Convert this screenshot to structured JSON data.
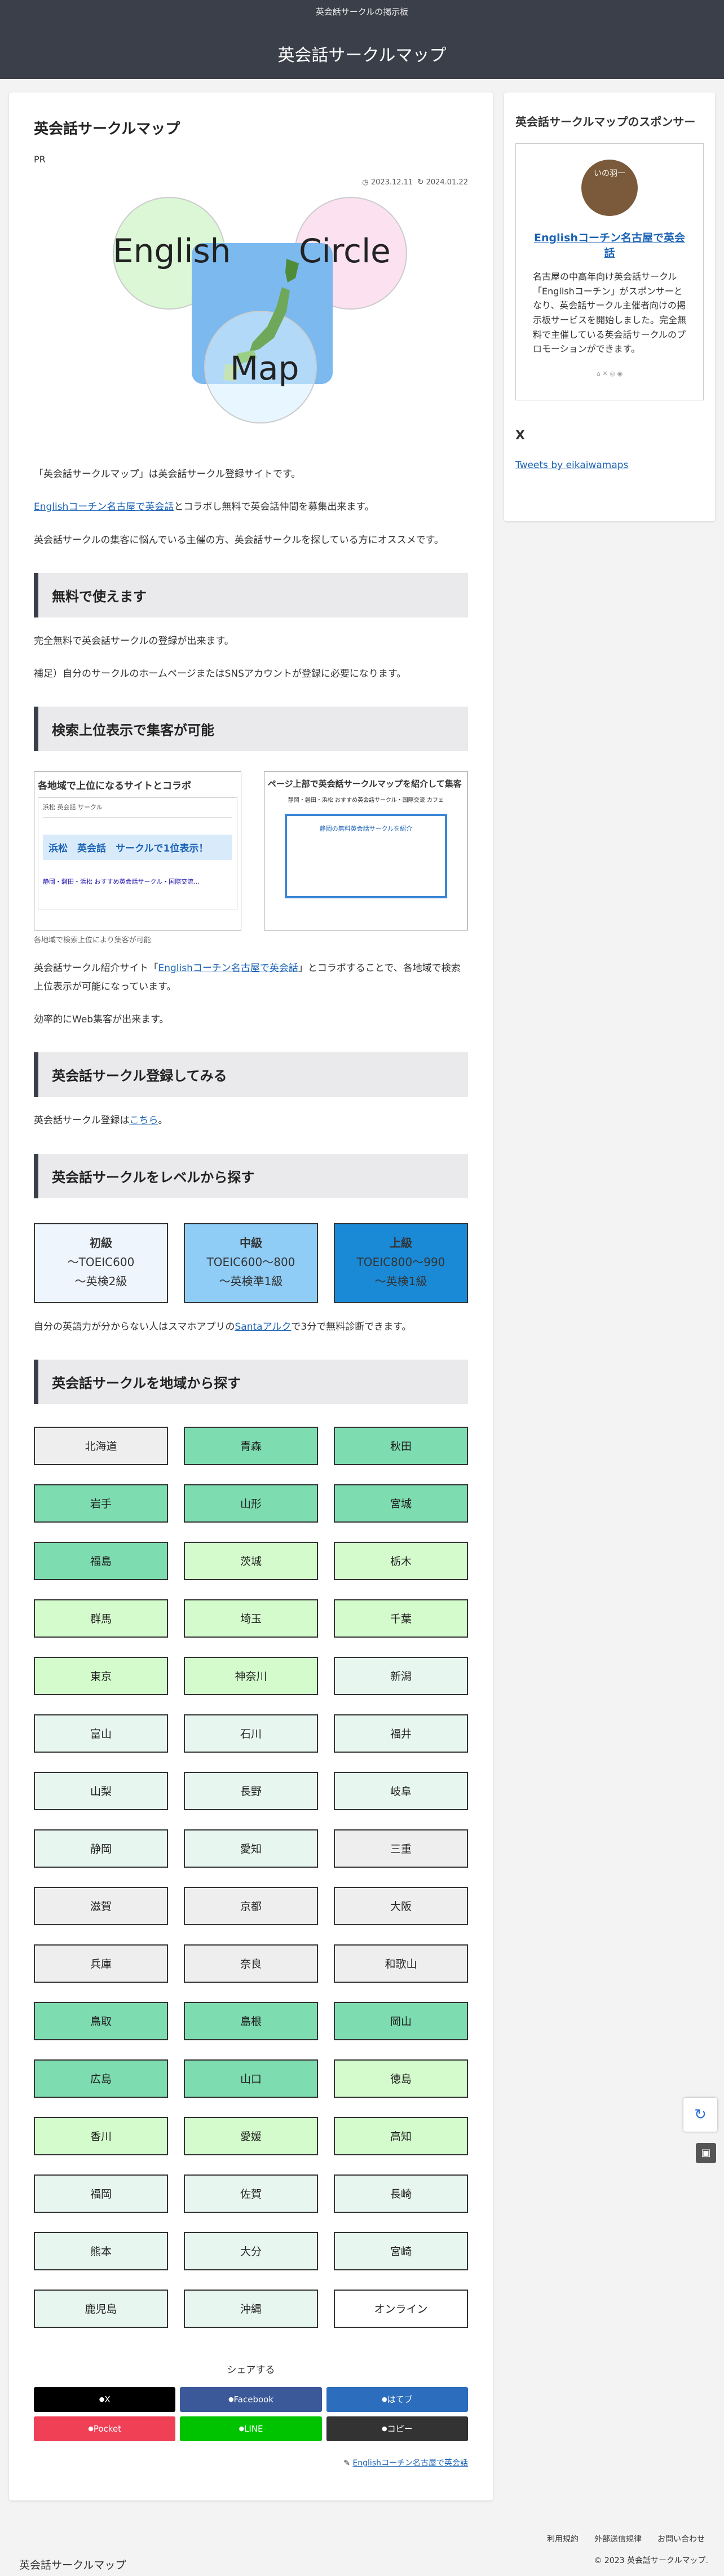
{
  "header": {
    "tagline": "英会話サークルの掲示板",
    "site_title": "英会話サークルマップ"
  },
  "article": {
    "title": "英会話サークルマップ",
    "pr": "PR",
    "created": "2023.12.11",
    "updated": "2024.01.22",
    "hero": {
      "word1": "English",
      "word2": "Circle",
      "word3": "Map"
    },
    "intro1": "「英会話サークルマップ」は英会話サークル登録サイトです。",
    "intro2_link": "Englishコーチン名古屋で英会話",
    "intro2_rest": "とコラボし無料で英会話仲間を募集出来ます。",
    "intro3": "英会話サークルの集客に悩んでいる主催の方、英会話サークルを探している方にオススメです。",
    "h_free": "無料で使えます",
    "free1": "完全無料で英会話サークルの登録が出来ます。",
    "free2": "補足）自分のサークルのホームページまたはSNSアカウントが登録に必要になります。",
    "h_seo": "検索上位表示で集客が可能",
    "shot1_title": "各地域で上位になるサイトとコラボ",
    "shot1_search": "浜松 英会話 サークル",
    "shot1_big": "浜松　英会話　サークルで1位表示！",
    "shot1_result": "静岡・磐田・浜松 おすすめ英会話サークル・国際交流…",
    "shot2_title": "ページ上部で英会話サークルマップを紹介して集客",
    "shot2_head": "静岡・磐田・浜松 おすすめ英会話サークル・国際交流 カフェ",
    "shot2_box": "静岡の無料英会話サークルを紹介",
    "caption": "各地域で検索上位により集客が可能",
    "seo1_pre": "英会話サークル紹介サイト「",
    "seo1_link": "Englishコーチン名古屋で英会話",
    "seo1_post": "」とコラボすることで、各地域で検索上位表示が可能になっています。",
    "seo2": "効率的にWeb集客が出来ます。",
    "h_register": "英会話サークル登録してみる",
    "reg_pre": "英会話サークル登録は",
    "reg_link": "こちら",
    "reg_post": "。",
    "h_level": "英会話サークルをレベルから探す",
    "levels": [
      {
        "name": "初級",
        "l1": "〜TOEIC600",
        "l2": "〜英検2級",
        "bg": "#eef5fd",
        "fg": "#222"
      },
      {
        "name": "中級",
        "l1": "TOEIC600〜800",
        "l2": "〜英検準1級",
        "bg": "#8fcdf6",
        "fg": "#222"
      },
      {
        "name": "上級",
        "l1": "TOEIC800〜990",
        "l2": "〜英検1級",
        "bg": "#1a8ad6",
        "fg": "#222"
      }
    ],
    "level_pre": "自分の英語力が分からない人はスマホアプリの",
    "level_link": "Santaアルク",
    "level_post": "で3分で無料診断できます。",
    "h_region": "英会話サークルを地域から探す",
    "prefectures": [
      {
        "n": "北海道",
        "c": "#eeeeee"
      },
      {
        "n": "青森",
        "c": "#7ddcb0"
      },
      {
        "n": "秋田",
        "c": "#7ddcb0"
      },
      {
        "n": "岩手",
        "c": "#7ddcb0"
      },
      {
        "n": "山形",
        "c": "#7ddcb0"
      },
      {
        "n": "宮城",
        "c": "#7ddcb0"
      },
      {
        "n": "福島",
        "c": "#7ddcb0"
      },
      {
        "n": "茨城",
        "c": "#d3fbcc"
      },
      {
        "n": "栃木",
        "c": "#d3fbcc"
      },
      {
        "n": "群馬",
        "c": "#d3fbcc"
      },
      {
        "n": "埼玉",
        "c": "#d3fbcc"
      },
      {
        "n": "千葉",
        "c": "#d3fbcc"
      },
      {
        "n": "東京",
        "c": "#d3fbcc"
      },
      {
        "n": "神奈川",
        "c": "#d3fbcc"
      },
      {
        "n": "新潟",
        "c": "#e8f6f0"
      },
      {
        "n": "富山",
        "c": "#e8f6f0"
      },
      {
        "n": "石川",
        "c": "#e8f6f0"
      },
      {
        "n": "福井",
        "c": "#e8f6f0"
      },
      {
        "n": "山梨",
        "c": "#e8f6f0"
      },
      {
        "n": "長野",
        "c": "#e8f6f0"
      },
      {
        "n": "岐阜",
        "c": "#e8f6f0"
      },
      {
        "n": "静岡",
        "c": "#e8f6f0"
      },
      {
        "n": "愛知",
        "c": "#e8f6f0"
      },
      {
        "n": "三重",
        "c": "#eeeeee"
      },
      {
        "n": "滋賀",
        "c": "#eeeeee"
      },
      {
        "n": "京都",
        "c": "#eeeeee"
      },
      {
        "n": "大阪",
        "c": "#eeeeee"
      },
      {
        "n": "兵庫",
        "c": "#eeeeee"
      },
      {
        "n": "奈良",
        "c": "#eeeeee"
      },
      {
        "n": "和歌山",
        "c": "#eeeeee"
      },
      {
        "n": "鳥取",
        "c": "#7ddcb0"
      },
      {
        "n": "島根",
        "c": "#7ddcb0"
      },
      {
        "n": "岡山",
        "c": "#7ddcb0"
      },
      {
        "n": "広島",
        "c": "#7ddcb0"
      },
      {
        "n": "山口",
        "c": "#7ddcb0"
      },
      {
        "n": "徳島",
        "c": "#d3fbcc"
      },
      {
        "n": "香川",
        "c": "#d3fbcc"
      },
      {
        "n": "愛媛",
        "c": "#d3fbcc"
      },
      {
        "n": "高知",
        "c": "#d3fbcc"
      },
      {
        "n": "福岡",
        "c": "#e8f6f0"
      },
      {
        "n": "佐賀",
        "c": "#e8f6f0"
      },
      {
        "n": "長崎",
        "c": "#e8f6f0"
      },
      {
        "n": "熊本",
        "c": "#e8f6f0"
      },
      {
        "n": "大分",
        "c": "#e8f6f0"
      },
      {
        "n": "宮崎",
        "c": "#e8f6f0"
      },
      {
        "n": "鹿児島",
        "c": "#e8f6f0"
      },
      {
        "n": "沖縄",
        "c": "#e8f6f0"
      },
      {
        "n": "オンライン",
        "c": "#ffffff"
      }
    ],
    "share_label": "シェアする",
    "share": [
      {
        "label": "X",
        "icon": "x-icon",
        "bg": "#000000"
      },
      {
        "label": "Facebook",
        "icon": "facebook-icon",
        "bg": "#3b5998"
      },
      {
        "label": "はてブ",
        "icon": "hatena-icon",
        "bg": "#2c6ebd"
      },
      {
        "label": "Pocket",
        "icon": "pocket-icon",
        "bg": "#ef4056"
      },
      {
        "label": "LINE",
        "icon": "line-icon",
        "bg": "#00c300"
      },
      {
        "label": "コピー",
        "icon": "copy-icon",
        "bg": "#333333"
      }
    ],
    "author_link": "Englishコーチン名古屋で英会話"
  },
  "sidebar": {
    "title": "英会話サークルマップのスポンサー",
    "avatar_text": "いの羽一",
    "sponsor_link": "Englishコーチン名古屋で英会話",
    "sponsor_desc": "名古屋の中高年向け英会話サークル「Englishコーチン」がスポンサーとなり、英会話サークル主催者向けの掲示板サービスを開始しました。完全無料で主催している英会話サークルのプロモーションができます。",
    "x_title": "X",
    "x_link": "Tweets by eikaiwamaps"
  },
  "footer": {
    "links": [
      "利用規約",
      "外部送信規律",
      "お問い合わせ"
    ],
    "brand": "英会話サークルマップ",
    "copyright": "© 2023 英会話サークルマップ."
  }
}
